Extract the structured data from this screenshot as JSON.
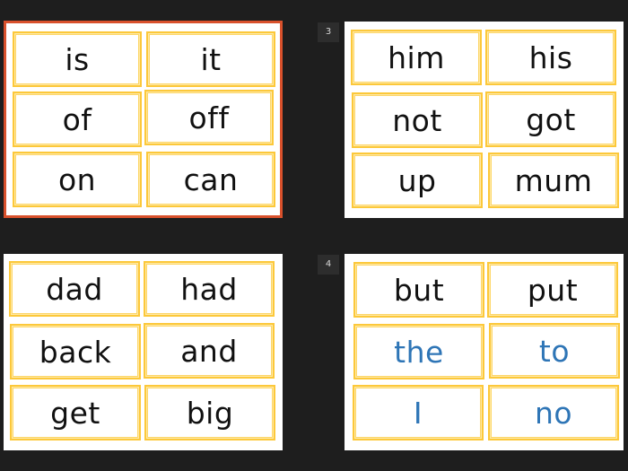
{
  "app": {
    "view": "Slide Sorter"
  },
  "colors": {
    "background": "#1e1e1e",
    "selection_border": "#d9512c",
    "card_border": "#fcc83a",
    "word_text": "#111111",
    "tricky_word_text": "#2e75b6"
  },
  "slides": [
    {
      "number": null,
      "selected": true,
      "words": [
        {
          "text": "is",
          "tricky": false
        },
        {
          "text": "it",
          "tricky": false
        },
        {
          "text": "of",
          "tricky": false
        },
        {
          "text": "off",
          "tricky": false
        },
        {
          "text": "on",
          "tricky": false
        },
        {
          "text": "can",
          "tricky": false
        }
      ]
    },
    {
      "number": "3",
      "selected": false,
      "words": [
        {
          "text": "him",
          "tricky": false
        },
        {
          "text": "his",
          "tricky": false
        },
        {
          "text": "not",
          "tricky": false
        },
        {
          "text": "got",
          "tricky": false
        },
        {
          "text": "up",
          "tricky": false
        },
        {
          "text": "mum",
          "tricky": false
        }
      ]
    },
    {
      "number": null,
      "selected": false,
      "words": [
        {
          "text": "dad",
          "tricky": false
        },
        {
          "text": "had",
          "tricky": false
        },
        {
          "text": "back",
          "tricky": false
        },
        {
          "text": "and",
          "tricky": false
        },
        {
          "text": "get",
          "tricky": false
        },
        {
          "text": "big",
          "tricky": false
        }
      ]
    },
    {
      "number": "4",
      "selected": false,
      "words": [
        {
          "text": "but",
          "tricky": false
        },
        {
          "text": "put",
          "tricky": false
        },
        {
          "text": "the",
          "tricky": true
        },
        {
          "text": "to",
          "tricky": true
        },
        {
          "text": "I",
          "tricky": true
        },
        {
          "text": "no",
          "tricky": true
        }
      ]
    }
  ]
}
